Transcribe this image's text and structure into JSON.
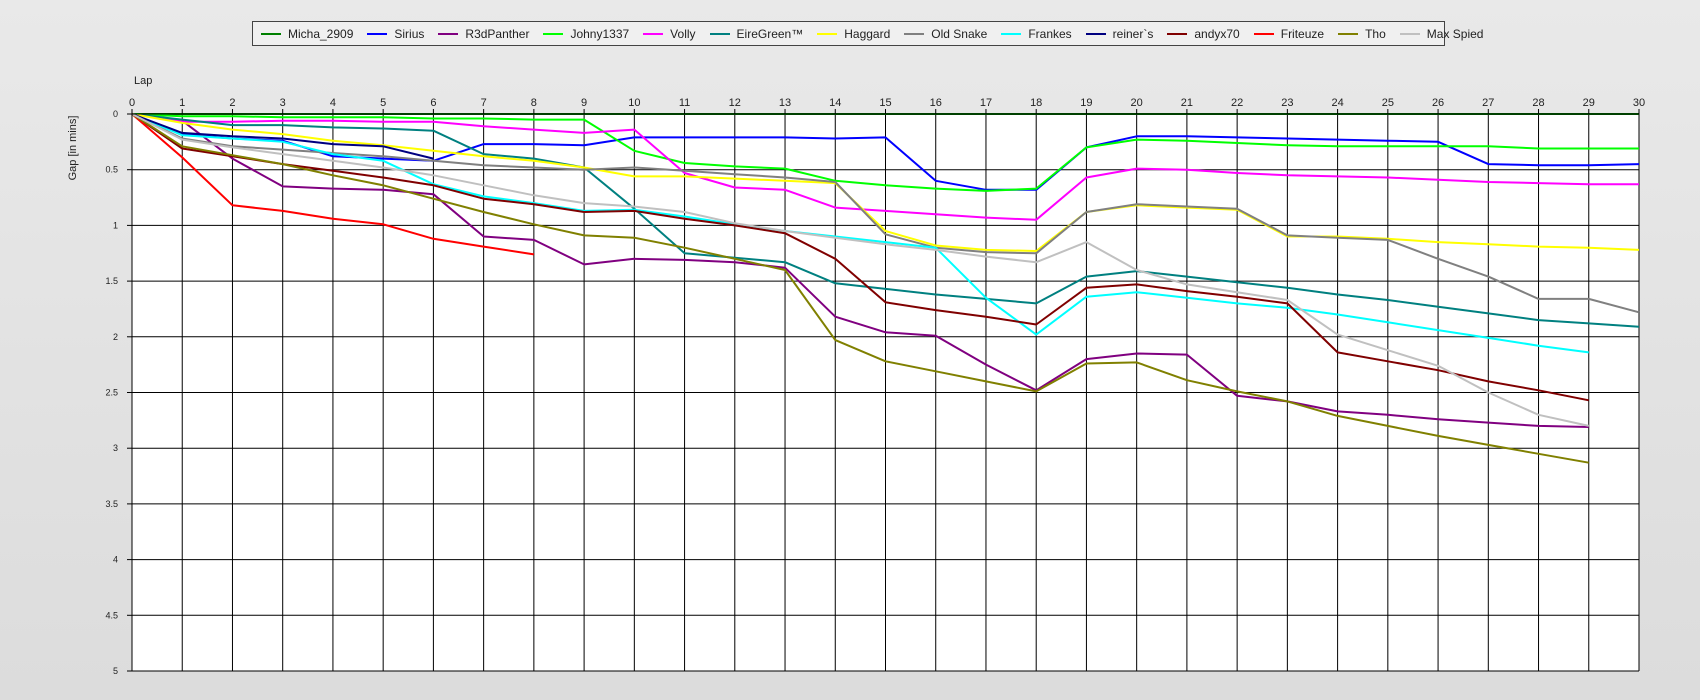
{
  "chart_data": {
    "type": "line",
    "xlabel": "Lap",
    "ylabel": "Gap [in mins]",
    "xlim": [
      0,
      30
    ],
    "ylim": [
      0,
      5
    ],
    "y_inverted": true,
    "grid": true,
    "legend_position": "top",
    "x_ticks": [
      0,
      1,
      2,
      3,
      4,
      5,
      6,
      7,
      8,
      9,
      10,
      11,
      12,
      13,
      14,
      15,
      16,
      17,
      18,
      19,
      20,
      21,
      22,
      23,
      24,
      25,
      26,
      27,
      28,
      29,
      30
    ],
    "y_ticks": [
      0,
      0.5,
      1,
      1.5,
      2,
      2.5,
      3,
      3.5,
      4,
      4.5,
      5
    ],
    "series": [
      {
        "name": "Micha_2909",
        "color": "#008000",
        "x": [
          0,
          1,
          2,
          3,
          4,
          5,
          6,
          7,
          8,
          9,
          10,
          11,
          12,
          13,
          14,
          15,
          16,
          17,
          18,
          19,
          20,
          21,
          22,
          23,
          24,
          25,
          26,
          27,
          28,
          29,
          30
        ],
        "y": [
          0,
          0,
          0,
          0,
          0,
          0,
          0,
          0,
          0,
          0,
          0,
          0,
          0,
          0,
          0,
          0,
          0,
          0,
          0,
          0,
          0,
          0,
          0,
          0,
          0,
          0,
          0,
          0,
          0,
          0,
          0
        ]
      },
      {
        "name": "Sirius",
        "color": "#0000ff",
        "x": [
          0,
          1,
          2,
          3,
          4,
          5,
          6,
          7,
          8,
          9,
          10,
          11,
          12,
          13,
          14,
          15,
          16,
          17,
          18,
          19,
          20,
          21,
          22,
          23,
          24,
          25,
          26,
          27,
          28,
          29,
          30
        ],
        "y": [
          0,
          0.18,
          0.22,
          0.24,
          0.38,
          0.4,
          0.42,
          0.27,
          0.27,
          0.28,
          0.21,
          0.21,
          0.21,
          0.21,
          0.22,
          0.21,
          0.6,
          0.68,
          0.68,
          0.3,
          0.2,
          0.2,
          0.21,
          0.22,
          0.23,
          0.24,
          0.25,
          0.45,
          0.46,
          0.46,
          0.45
        ]
      },
      {
        "name": "R3dPanther",
        "color": "#800080",
        "x": [
          0,
          1,
          2,
          3,
          4,
          5,
          6,
          7,
          8,
          9,
          10,
          11,
          12,
          13,
          14,
          15,
          16,
          17,
          18,
          19,
          20,
          21,
          22,
          23,
          24,
          25,
          26,
          27,
          28,
          29
        ],
        "y": [
          0,
          0.06,
          0.4,
          0.65,
          0.67,
          0.68,
          0.72,
          1.1,
          1.13,
          1.35,
          1.3,
          1.31,
          1.33,
          1.38,
          1.82,
          1.96,
          1.99,
          2.25,
          2.48,
          2.2,
          2.15,
          2.16,
          2.53,
          2.58,
          2.67,
          2.7,
          2.74,
          2.77,
          2.8,
          2.81
        ]
      },
      {
        "name": "Johny1337",
        "color": "#00ff00",
        "x": [
          0,
          1,
          2,
          3,
          4,
          5,
          6,
          7,
          8,
          9,
          10,
          11,
          12,
          13,
          14,
          15,
          16,
          17,
          18,
          19,
          20,
          21,
          22,
          23,
          24,
          25,
          26,
          27,
          28,
          29,
          30
        ],
        "y": [
          0,
          0.02,
          0.02,
          0.03,
          0.03,
          0.03,
          0.04,
          0.04,
          0.05,
          0.05,
          0.33,
          0.44,
          0.47,
          0.49,
          0.6,
          0.64,
          0.67,
          0.69,
          0.67,
          0.3,
          0.23,
          0.24,
          0.26,
          0.28,
          0.29,
          0.29,
          0.29,
          0.29,
          0.31,
          0.31,
          0.31
        ]
      },
      {
        "name": "Volly",
        "color": "#ff00ff",
        "x": [
          0,
          1,
          2,
          3,
          4,
          5,
          6,
          7,
          8,
          9,
          10,
          11,
          12,
          13,
          14,
          15,
          16,
          17,
          18,
          19,
          20,
          21,
          22,
          23,
          24,
          25,
          26,
          27,
          28,
          29,
          30
        ],
        "y": [
          0,
          0.07,
          0.07,
          0.06,
          0.06,
          0.07,
          0.07,
          0.11,
          0.14,
          0.17,
          0.14,
          0.53,
          0.66,
          0.68,
          0.84,
          0.87,
          0.9,
          0.93,
          0.95,
          0.57,
          0.49,
          0.5,
          0.53,
          0.55,
          0.56,
          0.57,
          0.59,
          0.61,
          0.62,
          0.63,
          0.63
        ]
      },
      {
        "name": "EireGreen™",
        "color": "#008080",
        "x": [
          0,
          1,
          2,
          3,
          4,
          5,
          6,
          7,
          8,
          9,
          10,
          11,
          12,
          13,
          14,
          15,
          16,
          17,
          18,
          19,
          20,
          21,
          22,
          23,
          24,
          25,
          26,
          27,
          28,
          29,
          30
        ],
        "y": [
          0,
          0.05,
          0.1,
          0.1,
          0.12,
          0.13,
          0.15,
          0.36,
          0.4,
          0.48,
          0.85,
          1.25,
          1.29,
          1.33,
          1.52,
          1.57,
          1.62,
          1.66,
          1.7,
          1.46,
          1.41,
          1.46,
          1.51,
          1.56,
          1.62,
          1.67,
          1.73,
          1.79,
          1.85,
          1.88,
          1.91
        ]
      },
      {
        "name": "Haggard",
        "color": "#ffff00",
        "x": [
          0,
          1,
          2,
          3,
          4,
          5,
          6,
          7,
          8,
          9,
          10,
          11,
          12,
          13,
          14,
          15,
          16,
          17,
          18,
          19,
          20,
          21,
          22,
          23,
          24,
          25,
          26,
          27,
          28,
          29,
          30
        ],
        "y": [
          0,
          0.08,
          0.14,
          0.18,
          0.24,
          0.28,
          0.33,
          0.38,
          0.42,
          0.48,
          0.56,
          0.56,
          0.58,
          0.6,
          0.62,
          1.05,
          1.18,
          1.22,
          1.23,
          0.88,
          0.82,
          0.84,
          0.86,
          1.1,
          1.1,
          1.12,
          1.15,
          1.17,
          1.19,
          1.2,
          1.22
        ]
      },
      {
        "name": "Old Snake",
        "color": "#808080",
        "x": [
          0,
          1,
          2,
          3,
          4,
          5,
          6,
          7,
          8,
          9,
          10,
          11,
          12,
          13,
          14,
          15,
          16,
          17,
          18,
          19,
          20,
          21,
          22,
          23,
          24,
          25,
          26,
          27,
          28,
          29,
          30
        ],
        "y": [
          0,
          0.22,
          0.29,
          0.32,
          0.35,
          0.38,
          0.42,
          0.46,
          0.48,
          0.5,
          0.48,
          0.51,
          0.54,
          0.57,
          0.61,
          1.08,
          1.2,
          1.24,
          1.25,
          0.88,
          0.81,
          0.83,
          0.85,
          1.09,
          1.11,
          1.13,
          1.3,
          1.46,
          1.66,
          1.66,
          1.78
        ]
      },
      {
        "name": "Frankes",
        "color": "#00ffff",
        "x": [
          0,
          1,
          2,
          3,
          4,
          5,
          6,
          7,
          8,
          9,
          10,
          11,
          12,
          13,
          14,
          15,
          16,
          17,
          18,
          19,
          20,
          21,
          22,
          23,
          24,
          25,
          26,
          27,
          28,
          29
        ],
        "y": [
          0,
          0.19,
          0.22,
          0.25,
          0.36,
          0.42,
          0.63,
          0.74,
          0.8,
          0.87,
          0.86,
          0.92,
          0.99,
          1.05,
          1.1,
          1.15,
          1.2,
          1.65,
          1.98,
          1.64,
          1.6,
          1.65,
          1.7,
          1.74,
          1.8,
          1.87,
          1.94,
          2.01,
          2.08,
          2.14
        ]
      },
      {
        "name": "reiner`s",
        "color": "#000080",
        "x": [
          0,
          1,
          2,
          3,
          4,
          5,
          6
        ],
        "y": [
          0,
          0.17,
          0.2,
          0.22,
          0.27,
          0.29,
          0.4
        ]
      },
      {
        "name": "andyx70",
        "color": "#800000",
        "x": [
          0,
          1,
          2,
          3,
          4,
          5,
          6,
          7,
          8,
          9,
          10,
          11,
          12,
          13,
          14,
          15,
          16,
          17,
          18,
          19,
          20,
          21,
          22,
          23,
          24,
          25,
          26,
          27,
          28,
          29
        ],
        "y": [
          0,
          0.31,
          0.38,
          0.45,
          0.51,
          0.57,
          0.64,
          0.76,
          0.81,
          0.88,
          0.87,
          0.94,
          1.0,
          1.07,
          1.3,
          1.69,
          1.76,
          1.82,
          1.89,
          1.56,
          1.53,
          1.59,
          1.64,
          1.7,
          2.14,
          2.22,
          2.3,
          2.4,
          2.48,
          2.57
        ]
      },
      {
        "name": "Friteuze",
        "color": "#ff0000",
        "x": [
          0,
          1,
          2,
          3,
          4,
          5,
          6,
          7,
          8
        ],
        "y": [
          0,
          0.39,
          0.82,
          0.87,
          0.94,
          0.99,
          1.12,
          1.19,
          1.26
        ]
      },
      {
        "name": "Tho",
        "color": "#808000",
        "x": [
          0,
          1,
          2,
          3,
          4,
          5,
          6,
          7,
          8,
          9,
          10,
          11,
          12,
          13,
          14,
          15,
          16,
          17,
          18,
          19,
          20,
          21,
          22,
          23,
          24,
          25,
          26,
          27,
          28,
          29
        ],
        "y": [
          0,
          0.29,
          0.37,
          0.45,
          0.55,
          0.64,
          0.76,
          0.88,
          0.99,
          1.09,
          1.11,
          1.2,
          1.3,
          1.4,
          2.03,
          2.22,
          2.31,
          2.4,
          2.49,
          2.24,
          2.23,
          2.39,
          2.49,
          2.58,
          2.71,
          2.8,
          2.89,
          2.97,
          3.05,
          3.13
        ]
      },
      {
        "name": "Max Spied",
        "color": "#c0c0c0",
        "x": [
          0,
          1,
          2,
          3,
          4,
          5,
          6,
          7,
          8,
          9,
          10,
          11,
          12,
          13,
          14,
          15,
          16,
          17,
          18,
          19,
          20,
          21,
          22,
          23,
          24,
          25,
          26,
          27,
          28,
          29
        ],
        "y": [
          0,
          0.23,
          0.3,
          0.36,
          0.42,
          0.48,
          0.55,
          0.64,
          0.73,
          0.8,
          0.83,
          0.88,
          0.98,
          1.05,
          1.11,
          1.17,
          1.22,
          1.28,
          1.33,
          1.15,
          1.4,
          1.53,
          1.6,
          1.67,
          1.98,
          2.12,
          2.26,
          2.5,
          2.7,
          2.8
        ]
      }
    ]
  }
}
